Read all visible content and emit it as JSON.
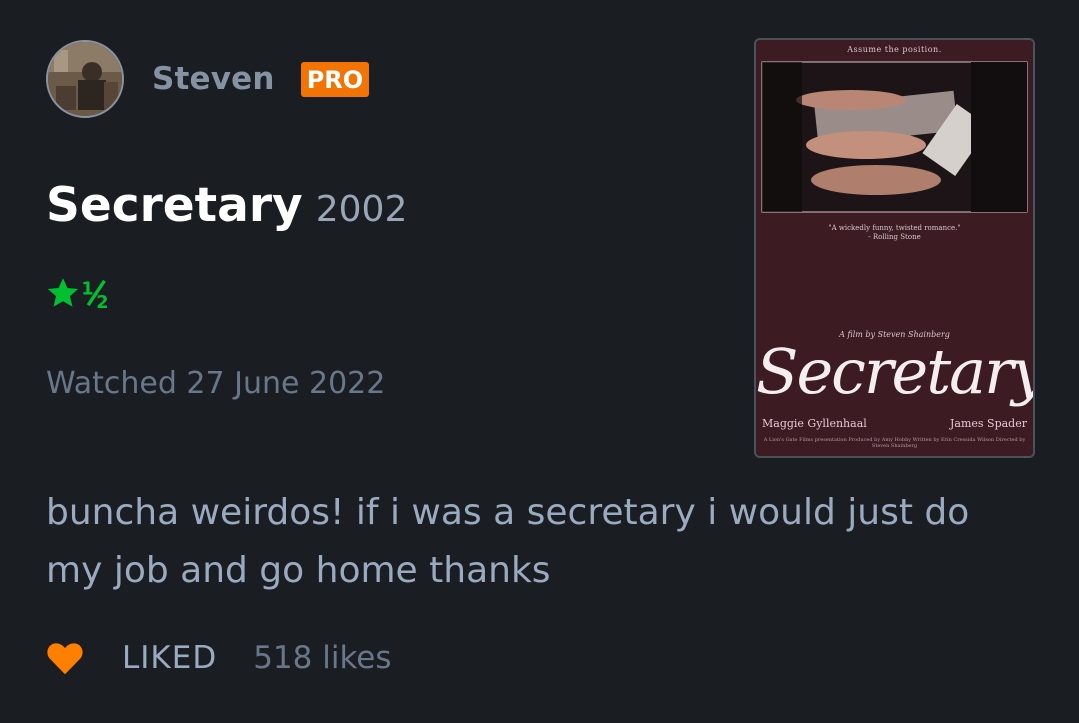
{
  "user": {
    "name": "Steven",
    "badge": "PRO"
  },
  "film": {
    "title": "Secretary",
    "year": "2002"
  },
  "rating": {
    "stars": 1.5,
    "max": 5,
    "color": "#00c030"
  },
  "watched": {
    "text": "Watched 27 June 2022"
  },
  "review": {
    "text": "buncha weirdos! if i was a secretary i would just do my job and go home thanks"
  },
  "footer": {
    "liked_label": "LIKED",
    "likes_count": "518 likes"
  },
  "poster": {
    "tagline": "Assume the position.",
    "quote": "\"A wickedly funny, twisted romance.\"",
    "quote_source": "- Rolling Stone",
    "credit_line": "A film by Steven Shainberg",
    "title": "Secretary",
    "actor_left": "Maggie Gyllenhaal",
    "actor_right": "James Spader",
    "billing": "A Lion's Gate Films presentation  Produced by Amy Hobby  Written by Erin Cressida Wilson  Directed by Steven Shainberg"
  },
  "colors": {
    "background": "#1a1d21",
    "pro_badge": "#f27405",
    "heart": "#ff8000",
    "star": "#00c030"
  },
  "icons": {
    "avatar": "user-avatar",
    "star": "star-icon",
    "half_star": "half-star-icon",
    "heart": "heart-icon"
  }
}
